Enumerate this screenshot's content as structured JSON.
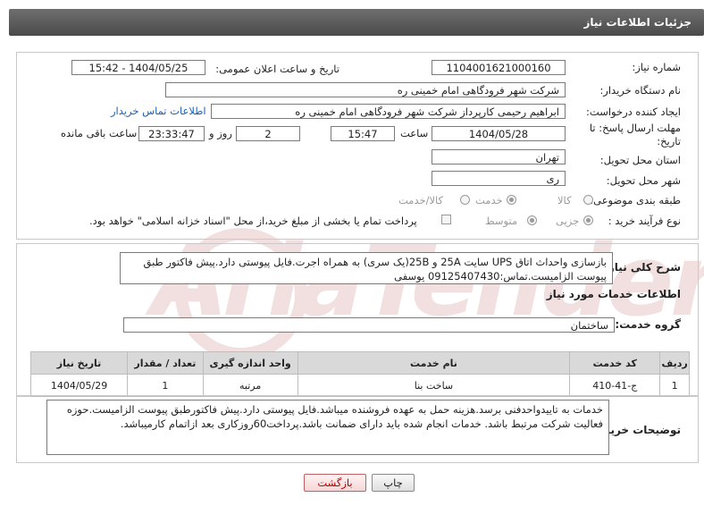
{
  "header": {
    "title": "جزئیات اطلاعات نیاز"
  },
  "form": {
    "need_number_label": "شماره نیاز:",
    "need_number": "1104001621000160",
    "announce_label": "تاریخ و ساعت اعلان عمومی:",
    "announce_value": "1404/05/25 - 15:42",
    "buyer_org_label": "نام دستگاه خریدار:",
    "buyer_org": "شرکت شهر فرودگاهی امام خمینی  ره",
    "creator_label": "ایجاد کننده درخواست:",
    "creator": "ابراهیم رحیمی کارپرداز شرکت شهر فرودگاهی امام خمینی  ره",
    "contact_link": "اطلاعات تماس خریدار",
    "deadline_label": "مهلت ارسال پاسخ: تا تاریخ:",
    "deadline_date": "1404/05/28",
    "time_label": "ساعت",
    "deadline_time": "15:47",
    "days_value": "2",
    "days_label": "روز و",
    "remaining_time": "23:33:47",
    "remaining_label": "ساعت باقی مانده",
    "province_label": "استان محل تحویل:",
    "province": "تهران",
    "city_label": "شهر محل تحویل:",
    "city": "ری",
    "category_label": "طبقه بندی موضوعی:",
    "category_options": [
      "کالا",
      "خدمت",
      "کالا/خدمت"
    ],
    "category_selected": "خدمت",
    "process_label": "نوع فرآیند خرید :",
    "process_options": [
      "جزیی",
      "متوسط"
    ],
    "process_selected": "جزیی",
    "payment_note": "پرداخت تمام یا بخشی از مبلغ خرید،از محل \"اسناد خزانه اسلامی\" خواهد بود."
  },
  "description": {
    "label": "شرح کلی نیاز:",
    "text": "بازسازی واحداث اتاق UPS سایت 25A و 25B(یک سری) به همراه اجرت.فایل پیوستی دارد.پیش فاکتور طبق پیوست الزامیست.تماس:09125407430 یوسفی"
  },
  "services": {
    "section_title": "اطلاعات خدمات مورد نیاز",
    "group_label": "گروه خدمت:",
    "group_value": "ساختمان",
    "columns": [
      "ردیف",
      "کد خدمت",
      "نام خدمت",
      "واحد اندازه گیری",
      "تعداد / مقدار",
      "تاریخ نیاز"
    ],
    "rows": [
      [
        "1",
        "ج-41-410",
        "ساخت بنا",
        "مرتبه",
        "1",
        "1404/05/29"
      ]
    ]
  },
  "buyer_notes": {
    "label": "توضیحات خریدار:",
    "text": "خدمات به تاییدواحدفنی برسد.هزینه حمل به عهده فروشنده میباشد.فایل پیوستی دارد.پیش فاکتورطبق پیوست الزامیست.حوزه فعالیت شرکت مرتبط باشد. خدمات انجام شده باید دارای ضمانت باشد.پرداخت60روزکاری بعد ازاتمام کارمیباشد."
  },
  "buttons": {
    "print": "چاپ",
    "back": "بازگشت"
  },
  "watermark": "AriaTender.neT"
}
